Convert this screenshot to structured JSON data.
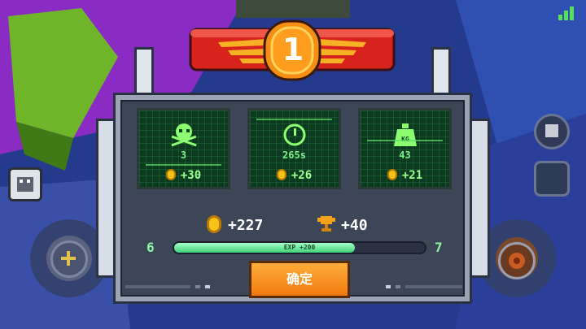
{
  "stats": [
    {
      "icon": "skull-icon",
      "value": "3",
      "reward": "+30"
    },
    {
      "icon": "clock-icon",
      "value": "265s",
      "reward": "+26"
    },
    {
      "icon": "weight-icon",
      "value": "43",
      "reward": "+21",
      "icon_text": "KG"
    }
  ],
  "rank": "1",
  "totals": {
    "coins": "+227",
    "trophies": "+40"
  },
  "level": {
    "current": "6",
    "next": "7",
    "exp_label": "EXP +200",
    "progress": 0.72
  },
  "confirm_label": "确定",
  "colors": {
    "accent_orange": "#f07a10",
    "screen_green": "#0c3a1e",
    "text_green": "#7df28a",
    "coin_gold": "#f7c21a"
  }
}
